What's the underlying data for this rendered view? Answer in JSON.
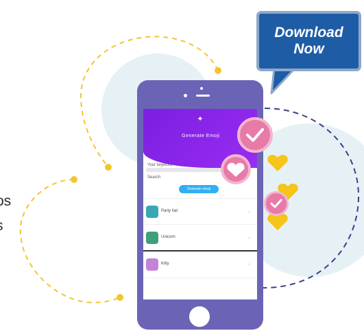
{
  "side_text": [
    "os",
    "s"
  ],
  "callout": {
    "line1": "Download",
    "line2": "Now"
  },
  "app": {
    "header_title": "Generate Emoji",
    "section_label": "Your keyword",
    "field_label": "Search",
    "button_label": "Generate emoji",
    "items": [
      {
        "name": "Party hat",
        "emoji_color": "#3aa7b6"
      },
      {
        "name": "Unicorn",
        "emoji_color": "#3f9f7a"
      },
      {
        "name": "Kitty",
        "emoji_color": "#c583d8"
      }
    ]
  },
  "colors": {
    "phone": "#6b64b6",
    "header": "#8424ea",
    "button": "#33aef2",
    "badge": "#e87aa8",
    "heart": "#f6c41a",
    "callout": "#1e5da6",
    "dash_yellow": "#f3c52d",
    "dash_navy": "#3b3f8a",
    "bg_circle": "#e6f1f5"
  },
  "icons": [
    "check-icon",
    "heart-icon",
    "heart-icon",
    "check-icon"
  ]
}
